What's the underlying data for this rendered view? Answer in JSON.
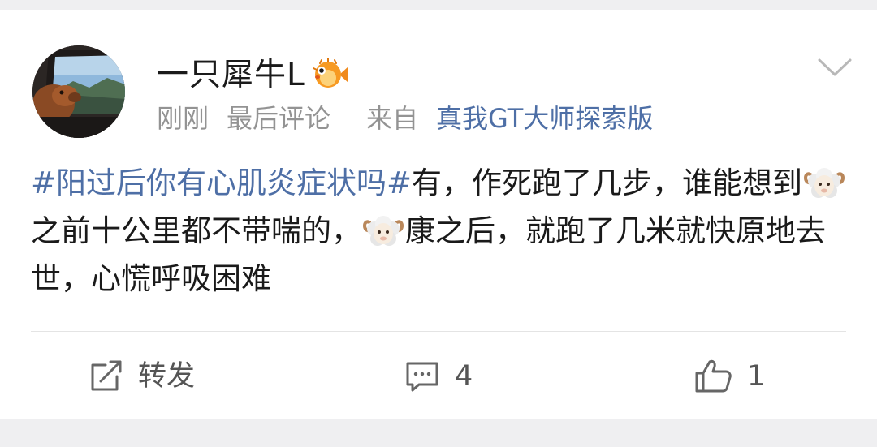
{
  "post": {
    "username": "一只犀牛L",
    "time": "刚刚",
    "last_comment": "最后评论",
    "from_label": "来自",
    "source": "真我GT大师探索版",
    "hashtag": "#阳过后你有心肌炎症状吗#",
    "text_part1": "有，作死跑了几步，谁能想到",
    "text_part2": "之前十公里都不带喘的，",
    "text_part3": "康之后，就跑了几米就快原地去世，心慌呼吸困难"
  },
  "actions": {
    "repost_label": "转发",
    "comment_count": "4",
    "like_count": "1"
  },
  "colors": {
    "link": "#4e6fa6",
    "meta": "#939393",
    "text": "#1a1a1a",
    "page_bg": "#efeff1"
  },
  "icons": [
    "avatar-photo",
    "pufferfish-badge-icon",
    "chevron-down-icon",
    "sheep-emoji-icon",
    "repost-icon",
    "comment-icon",
    "thumbs-up-icon"
  ]
}
